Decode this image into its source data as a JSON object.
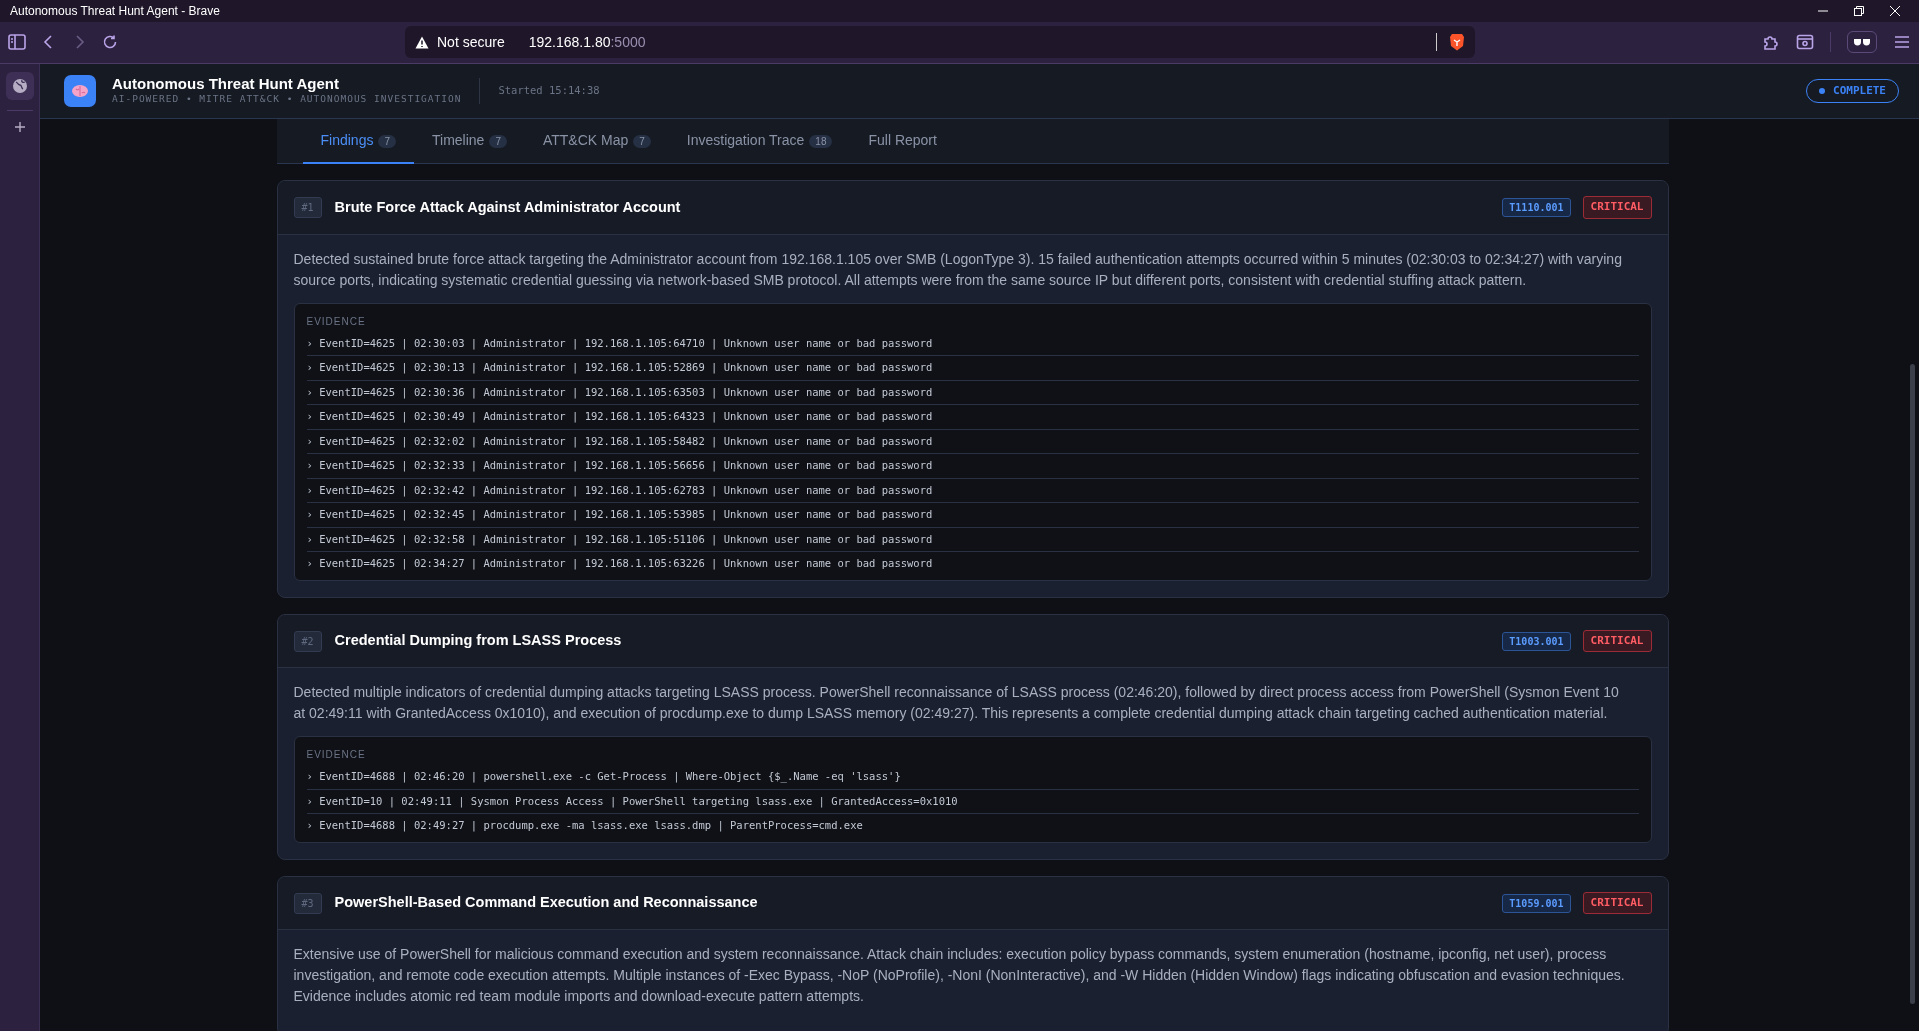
{
  "browser": {
    "title": "Autonomous Threat Hunt Agent - Brave",
    "security": "Not secure",
    "url_host": "192.168.1.80",
    "url_port": ":5000"
  },
  "app": {
    "title": "Autonomous Threat Hunt Agent",
    "subtitle": "AI-POWERED • MITRE ATT&CK • AUTONOMOUS INVESTIGATION",
    "started": "Started 15:14:38",
    "status": "COMPLETE"
  },
  "tabs": [
    {
      "label": "Findings",
      "count": "7",
      "selected": true
    },
    {
      "label": "Timeline",
      "count": "7",
      "selected": false
    },
    {
      "label": "ATT&CK Map",
      "count": "7",
      "selected": false
    },
    {
      "label": "Investigation Trace",
      "count": "18",
      "selected": false
    },
    {
      "label": "Full Report",
      "selected": false
    }
  ],
  "findings": [
    {
      "number": "#1",
      "title": "Brute Force Attack Against Administrator Account",
      "technique": "T1110.001",
      "severity": "CRITICAL",
      "kind": "critical",
      "description": "Detected sustained brute force attack targeting the Administrator account from 192.168.1.105 over SMB (LogonType 3). 15 failed authentication attempts occurred within 5 minutes (02:30:03 to 02:34:27) with varying source ports, indicating systematic credential guessing via network-based SMB protocol. All attempts were from the same source IP but different ports, consistent with credential stuffing attack pattern.",
      "evidence_label": "EVIDENCE",
      "evidence": [
        "› EventID=4625 | 02:30:03 | Administrator | 192.168.1.105:64710 | Unknown user name or bad password",
        "› EventID=4625 | 02:30:13 | Administrator | 192.168.1.105:52869 | Unknown user name or bad password",
        "› EventID=4625 | 02:30:36 | Administrator | 192.168.1.105:63503 | Unknown user name or bad password",
        "› EventID=4625 | 02:30:49 | Administrator | 192.168.1.105:64323 | Unknown user name or bad password",
        "› EventID=4625 | 02:32:02 | Administrator | 192.168.1.105:58482 | Unknown user name or bad password",
        "› EventID=4625 | 02:32:33 | Administrator | 192.168.1.105:56656 | Unknown user name or bad password",
        "› EventID=4625 | 02:32:42 | Administrator | 192.168.1.105:62783 | Unknown user name or bad password",
        "› EventID=4625 | 02:32:45 | Administrator | 192.168.1.105:53985 | Unknown user name or bad password",
        "› EventID=4625 | 02:32:58 | Administrator | 192.168.1.105:51106 | Unknown user name or bad password",
        "› EventID=4625 | 02:34:27 | Administrator | 192.168.1.105:63226 | Unknown user name or bad password"
      ]
    },
    {
      "number": "#2",
      "title": "Credential Dumping from LSASS Process",
      "technique": "T1003.001",
      "severity": "CRITICAL",
      "kind": "critical",
      "description": "Detected multiple indicators of credential dumping attacks targeting LSASS process. PowerShell reconnaissance of LSASS process (02:46:20), followed by direct process access from PowerShell (Sysmon Event 10 at 02:49:11 with GrantedAccess 0x1010), and execution of procdump.exe to dump LSASS memory (02:49:27). This represents a complete credential dumping attack chain targeting cached authentication material.",
      "evidence_label": "EVIDENCE",
      "evidence": [
        "› EventID=4688 | 02:46:20 | powershell.exe -c Get-Process | Where-Object {$_.Name -eq 'lsass'}",
        "› EventID=10 | 02:49:11 | Sysmon Process Access | PowerShell targeting lsass.exe | GrantedAccess=0x1010",
        "› EventID=4688 | 02:49:27 | procdump.exe -ma lsass.exe lsass.dmp | ParentProcess=cmd.exe"
      ]
    },
    {
      "number": "#3",
      "title": "PowerShell-Based Command Execution and Reconnaissance",
      "technique": "T1059.001",
      "severity": "CRITICAL",
      "kind": "critical",
      "description": "Extensive use of PowerShell for malicious command execution and system reconnaissance. Attack chain includes: execution policy bypass commands, system enumeration (hostname, ipconfig, net user), process investigation, and remote code execution attempts. Multiple instances of -Exec Bypass, -NoP (NoProfile), -NonI (NonInteractive), and -W Hidden (Hidden Window) flags indicating obfuscation and evasion techniques. Evidence includes atomic red team module imports and download-execute pattern attempts."
    }
  ]
}
